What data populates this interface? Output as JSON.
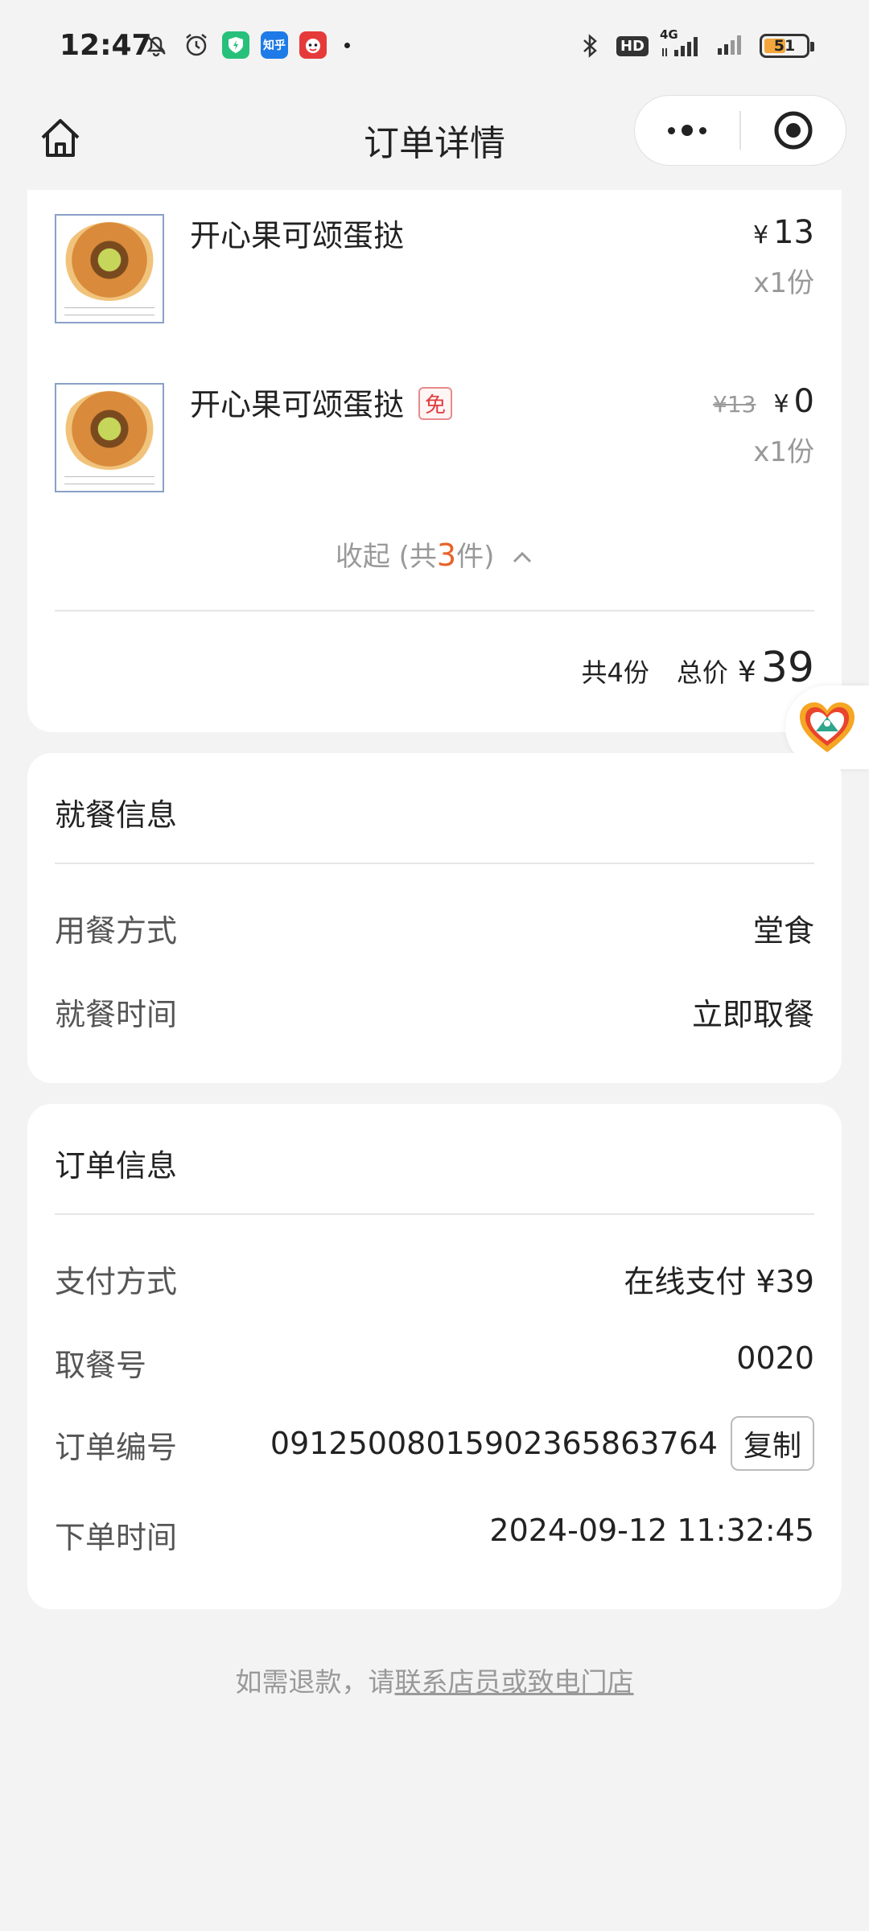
{
  "status_bar": {
    "time": "12:47",
    "left_icons": [
      "mute-bell-icon",
      "alarm-icon",
      "app-shield-icon",
      "zhihu-app-icon",
      "app-mascot-icon"
    ],
    "zhihu_label": "知乎",
    "network": "4G",
    "hd_label": "HD",
    "battery_percent": "51"
  },
  "nav": {
    "title": "订单详情"
  },
  "items": [
    {
      "name": "开心果可颂蛋挞",
      "yen": "¥",
      "price": "13",
      "qty": "x1份"
    },
    {
      "name": "开心果可颂蛋挞",
      "free_tag": "免",
      "original_price": "¥13",
      "yen": "¥",
      "price": "0",
      "qty": "x1份"
    }
  ],
  "collapse": {
    "prefix": "收起 (共",
    "count": "3",
    "suffix": "件)"
  },
  "summary": {
    "count_label": "共4份",
    "total_label": "总价",
    "yen": "¥",
    "total": "39"
  },
  "dining": {
    "title": "就餐信息",
    "rows": [
      {
        "label": "用餐方式",
        "value": "堂食"
      },
      {
        "label": "就餐时间",
        "value": "立即取餐"
      }
    ]
  },
  "order": {
    "title": "订单信息",
    "rows": [
      {
        "label": "支付方式",
        "value": "在线支付 ¥39"
      },
      {
        "label": "取餐号",
        "value": "0020"
      },
      {
        "label": "订单编号",
        "value": "09125008015902365863764",
        "action": "复制"
      },
      {
        "label": "下单时间",
        "value": "2024-09-12 11:32:45"
      }
    ]
  },
  "footer": {
    "prefix": "如需退款，请",
    "link": "联系店员或致电门店"
  },
  "colors": {
    "accent_orange": "#e8632a",
    "free_red": "#e03c3c",
    "page_bg": "#f3f3f3"
  }
}
